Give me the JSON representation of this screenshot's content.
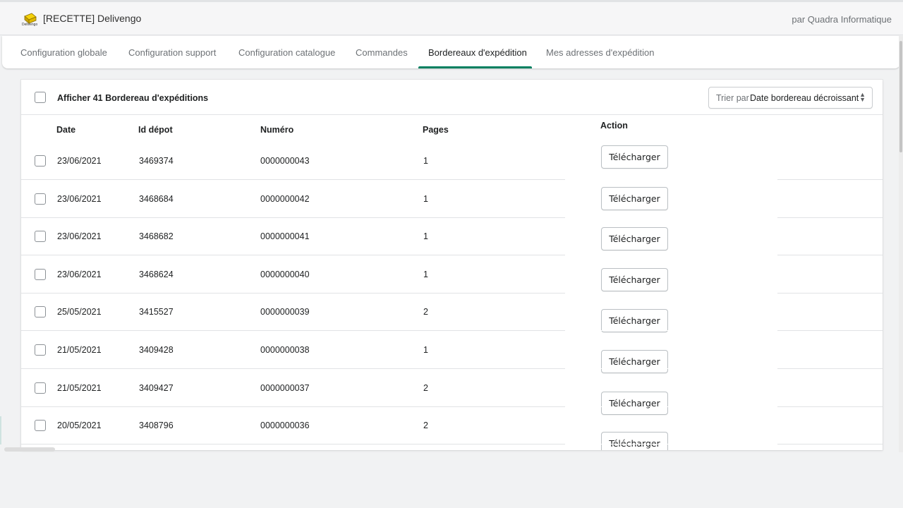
{
  "header": {
    "app_title": "[RECETTE] Delivengo",
    "logo_text": "Delivengo",
    "byline": "par Quadra Informatique"
  },
  "tabs": [
    {
      "label": "Configuration globale",
      "active": false
    },
    {
      "label": "Configuration support",
      "active": false
    },
    {
      "label": "Configuration catalogue",
      "active": false
    },
    {
      "label": "Commandes",
      "active": false
    },
    {
      "label": "Bordereaux d'expédition",
      "active": true
    },
    {
      "label": "Mes adresses d'expédition",
      "active": false
    }
  ],
  "list": {
    "bulk_label": "Afficher 41 Bordereau d'expéditions",
    "sort_prefix": "Trier par",
    "sort_value": "Date bordereau décroissant",
    "columns": {
      "date": "Date",
      "id_depot": "Id dépot",
      "numero": "Numéro",
      "pages": "Pages",
      "action": "Action"
    },
    "download_label": "Télécharger",
    "rows": [
      {
        "date": "23/06/2021",
        "id_depot": "3469374",
        "numero": "0000000043",
        "pages": "1"
      },
      {
        "date": "23/06/2021",
        "id_depot": "3468684",
        "numero": "0000000042",
        "pages": "1"
      },
      {
        "date": "23/06/2021",
        "id_depot": "3468682",
        "numero": "0000000041",
        "pages": "1"
      },
      {
        "date": "23/06/2021",
        "id_depot": "3468624",
        "numero": "0000000040",
        "pages": "1"
      },
      {
        "date": "25/05/2021",
        "id_depot": "3415527",
        "numero": "0000000039",
        "pages": "2"
      },
      {
        "date": "21/05/2021",
        "id_depot": "3409428",
        "numero": "0000000038",
        "pages": "1"
      },
      {
        "date": "21/05/2021",
        "id_depot": "3409427",
        "numero": "0000000037",
        "pages": "2"
      },
      {
        "date": "20/05/2021",
        "id_depot": "3408796",
        "numero": "0000000036",
        "pages": "2"
      }
    ]
  },
  "colors": {
    "accent": "#008060",
    "logo_yellow": "#f5d20a"
  }
}
